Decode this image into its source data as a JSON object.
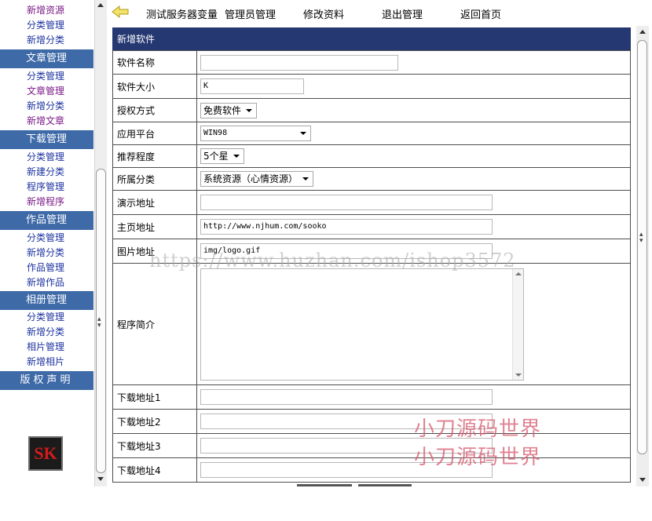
{
  "sidebar": {
    "items": [
      {
        "type": "link",
        "label": "新增资源",
        "color": "purple"
      },
      {
        "type": "link",
        "label": "分类管理",
        "color": "blue"
      },
      {
        "type": "link",
        "label": "新增分类",
        "color": "blue"
      },
      {
        "type": "head",
        "label": "文章管理"
      },
      {
        "type": "link",
        "label": "分类管理",
        "color": "blue"
      },
      {
        "type": "link",
        "label": "文章管理",
        "color": "purple"
      },
      {
        "type": "link",
        "label": "新增分类",
        "color": "blue"
      },
      {
        "type": "link",
        "label": "新增文章",
        "color": "purple"
      },
      {
        "type": "head",
        "label": "下载管理"
      },
      {
        "type": "link",
        "label": "分类管理",
        "color": "blue"
      },
      {
        "type": "link",
        "label": "新建分类",
        "color": "blue"
      },
      {
        "type": "link",
        "label": "程序管理",
        "color": "blue"
      },
      {
        "type": "link",
        "label": "新增程序",
        "color": "purple"
      },
      {
        "type": "head",
        "label": "作品管理"
      },
      {
        "type": "link",
        "label": "分类管理",
        "color": "blue"
      },
      {
        "type": "link",
        "label": "新增分类",
        "color": "blue"
      },
      {
        "type": "link",
        "label": "作品管理",
        "color": "blue"
      },
      {
        "type": "link",
        "label": "新增作品",
        "color": "blue"
      },
      {
        "type": "head",
        "label": "相册管理"
      },
      {
        "type": "link",
        "label": "分类管理",
        "color": "blue"
      },
      {
        "type": "link",
        "label": "新增分类",
        "color": "blue"
      },
      {
        "type": "link",
        "label": "相片管理",
        "color": "blue"
      },
      {
        "type": "link",
        "label": "新增相片",
        "color": "blue"
      }
    ],
    "copyright_label": "版权声明",
    "logo_text": "SK"
  },
  "topbar": {
    "links": [
      "测试服务器变量",
      "管理员管理",
      "修改资料",
      "退出管理",
      "返回首页"
    ]
  },
  "form": {
    "title": "新增软件",
    "name_label": "软件名称",
    "name_value": "",
    "size_label": "软件大小",
    "size_value": "K",
    "license_label": "授权方式",
    "license_value": "免费软件",
    "platform_label": "应用平台",
    "platform_value": "WIN98",
    "rating_label": "推荐程度",
    "rating_value": "5个星",
    "category_label": "所属分类",
    "category_value": "系统资源（心情资源）",
    "demo_label": "演示地址",
    "demo_value": "",
    "homepage_label": "主页地址",
    "homepage_value": "http://www.njhum.com/sooko",
    "image_label": "图片地址",
    "image_value": "img/logo.gif",
    "intro_label": "程序简介",
    "intro_value": "",
    "download1_label": "下载地址1",
    "download2_label": "下载地址2",
    "download3_label": "下载地址3",
    "download4_label": "下载地址4"
  },
  "watermarks": {
    "url": "https://www.huzhan.com/ishop3572",
    "brand": "小刀源码世界"
  },
  "colors": {
    "sidebar_head": "#3e6aa8",
    "form_title_bg": "#253872",
    "link_blue": "#1d33a0",
    "link_purple": "#7a1a86"
  }
}
